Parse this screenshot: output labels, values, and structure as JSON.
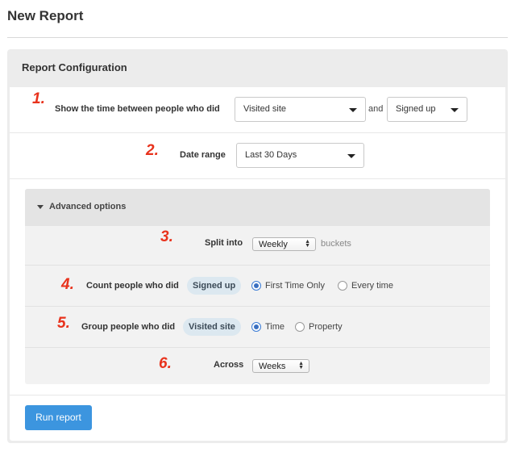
{
  "page": {
    "title": "New Report"
  },
  "config": {
    "title": "Report Configuration",
    "step1": {
      "number": "1.",
      "label": "Show the time between people who did",
      "event_a": "Visited site",
      "conjunction": "and",
      "event_b": "Signed up"
    },
    "step2": {
      "number": "2.",
      "label": "Date range",
      "value": "Last 30 Days"
    },
    "advanced": {
      "title": "Advanced options",
      "step3": {
        "number": "3.",
        "label": "Split into",
        "value": "Weekly",
        "suffix": "buckets"
      },
      "step4": {
        "number": "4.",
        "label": "Count people who did",
        "event": "Signed up",
        "options": [
          "First Time Only",
          "Every time"
        ],
        "selected": "First Time Only"
      },
      "step5": {
        "number": "5.",
        "label": "Group people who did",
        "event": "Visited site",
        "options": [
          "Time",
          "Property"
        ],
        "selected": "Time"
      },
      "step6": {
        "number": "6.",
        "label": "Across",
        "value": "Weeks"
      }
    },
    "run_label": "Run report"
  }
}
